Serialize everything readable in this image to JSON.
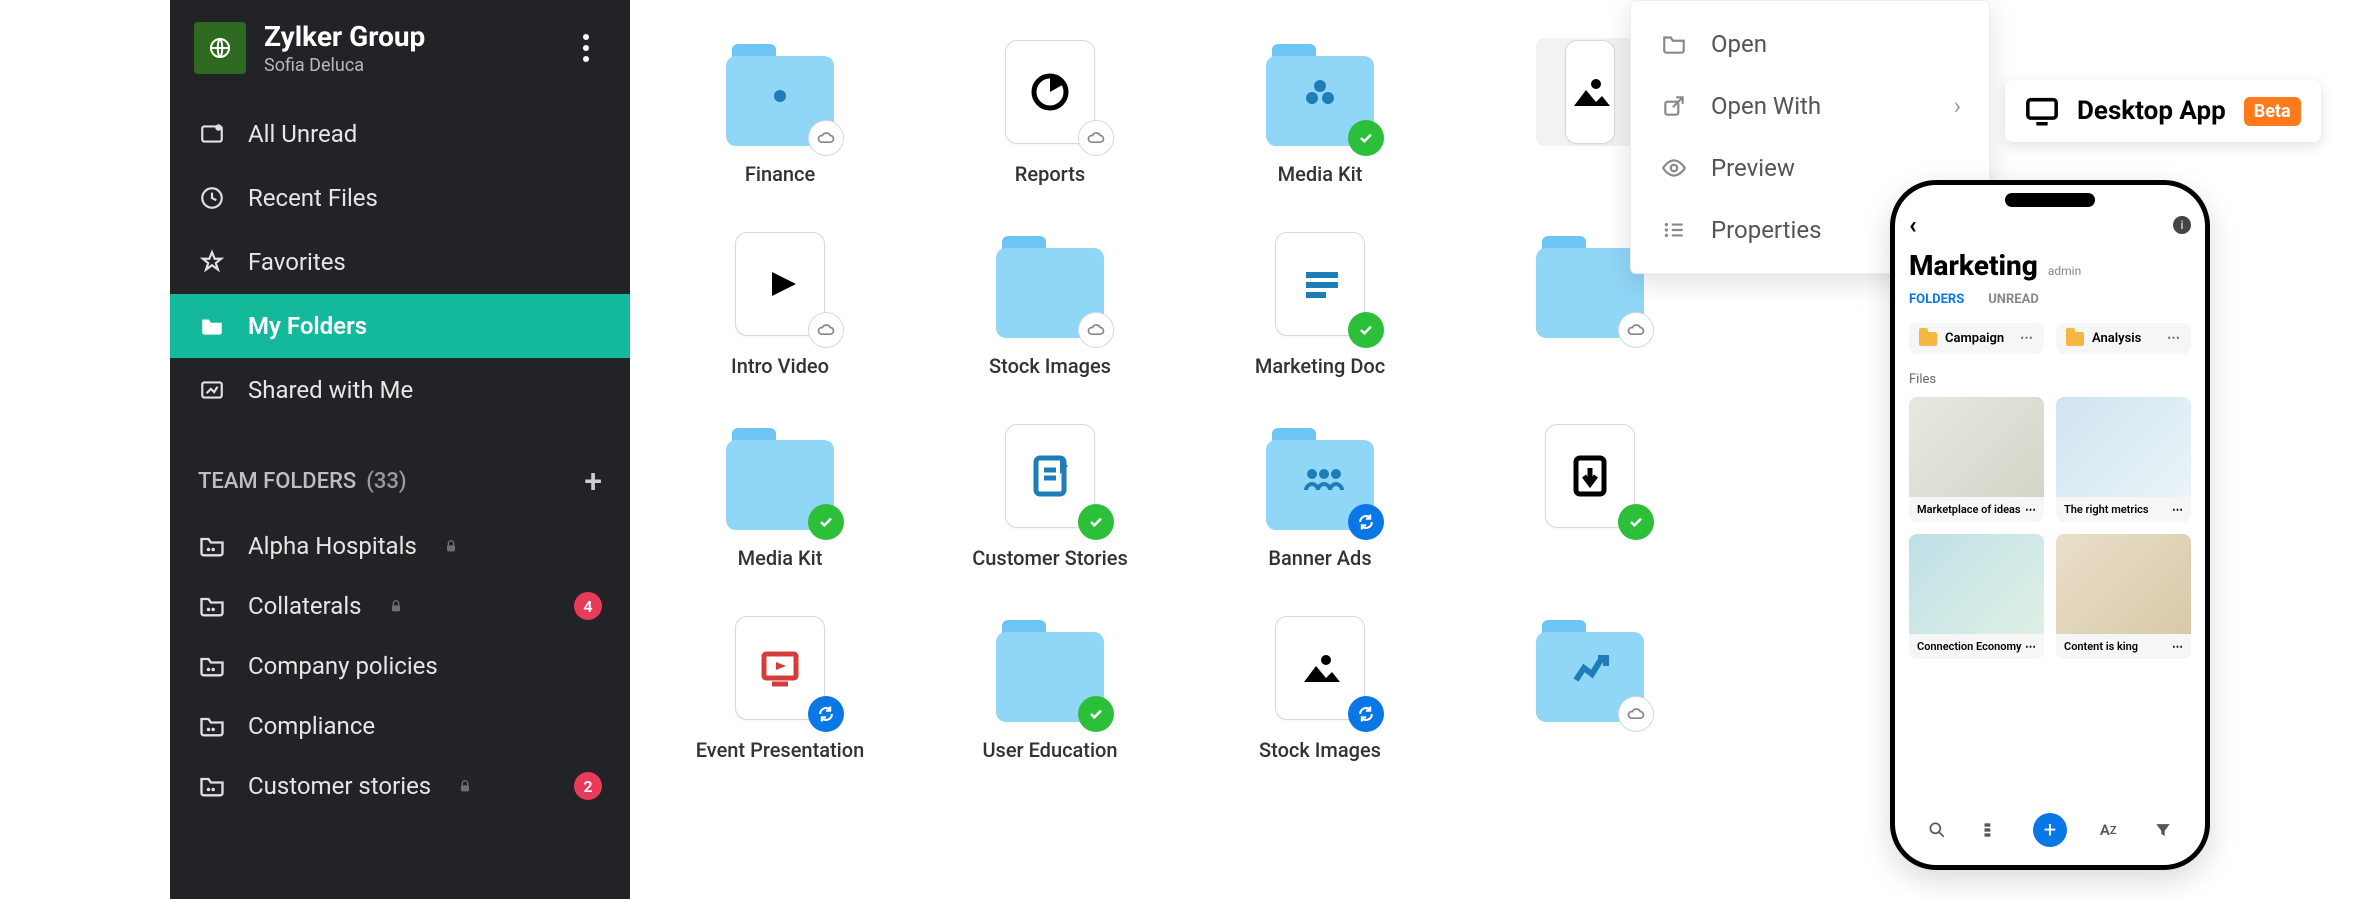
{
  "sidebar": {
    "org_name": "Zylker Group",
    "user_name": "Sofia Deluca",
    "nav": [
      {
        "label": "All Unread"
      },
      {
        "label": "Recent Files"
      },
      {
        "label": "Favorites"
      },
      {
        "label": "My Folders"
      },
      {
        "label": "Shared with Me"
      }
    ],
    "team_section_label": "TEAM FOLDERS",
    "team_section_count": "(33)",
    "team": [
      {
        "label": "Alpha Hospitals",
        "locked": true
      },
      {
        "label": "Collaterals",
        "locked": true,
        "badge": "4"
      },
      {
        "label": "Company policies"
      },
      {
        "label": "Compliance"
      },
      {
        "label": "Customer stories",
        "locked": true,
        "badge": "2"
      }
    ]
  },
  "grid": [
    {
      "label": "Finance",
      "kind": "folder",
      "glyph": "dot",
      "status": "cloud"
    },
    {
      "label": "Reports",
      "kind": "file",
      "glyph": "pie",
      "status": "cloud"
    },
    {
      "label": "Media Kit",
      "kind": "folder",
      "glyph": "dots3",
      "status": "ok"
    },
    {
      "label": "",
      "kind": "file",
      "glyph": "image",
      "status": "none",
      "selected": true
    },
    {
      "label": "Intro Video",
      "kind": "file",
      "glyph": "play",
      "status": "cloud"
    },
    {
      "label": "Stock Images",
      "kind": "folder",
      "glyph": "none",
      "status": "cloud"
    },
    {
      "label": "Marketing Doc",
      "kind": "file",
      "glyph": "lines",
      "status": "ok"
    },
    {
      "label": "",
      "kind": "folder",
      "glyph": "none",
      "status": "cloud"
    },
    {
      "label": "Media Kit",
      "kind": "folder",
      "glyph": "none",
      "status": "ok"
    },
    {
      "label": "Customer Stories",
      "kind": "file",
      "glyph": "doc",
      "status": "ok"
    },
    {
      "label": "Banner Ads",
      "kind": "folder",
      "glyph": "people",
      "status": "sync"
    },
    {
      "label": "",
      "kind": "file",
      "glyph": "pdf",
      "status": "ok"
    },
    {
      "label": "Event Presentation",
      "kind": "file",
      "glyph": "slides",
      "status": "sync"
    },
    {
      "label": "User Education",
      "kind": "folder",
      "glyph": "none",
      "status": "ok"
    },
    {
      "label": "Stock Images",
      "kind": "file",
      "glyph": "image",
      "status": "sync"
    },
    {
      "label": "",
      "kind": "folder",
      "glyph": "chart",
      "status": "cloud"
    }
  ],
  "context_menu": {
    "items": [
      {
        "label": "Open",
        "icon": "folder-icon"
      },
      {
        "label": "Open With",
        "icon": "external-icon",
        "submenu": true
      },
      {
        "label": "Preview",
        "icon": "eye-icon"
      },
      {
        "label": "Properties",
        "icon": "list-icon"
      }
    ]
  },
  "desktop_tag": {
    "label": "Desktop App",
    "badge": "Beta"
  },
  "mobile": {
    "title": "Marketing",
    "admin": "admin",
    "tabs": [
      {
        "label": "FOLDERS",
        "active": true
      },
      {
        "label": "UNREAD"
      }
    ],
    "folders": [
      {
        "label": "Campaign"
      },
      {
        "label": "Analysis"
      }
    ],
    "files_label": "Files",
    "files": [
      {
        "label": "Marketplace of ideas"
      },
      {
        "label": "The right metrics"
      },
      {
        "label": "Connection Economy"
      },
      {
        "label": "Content is king"
      }
    ]
  }
}
